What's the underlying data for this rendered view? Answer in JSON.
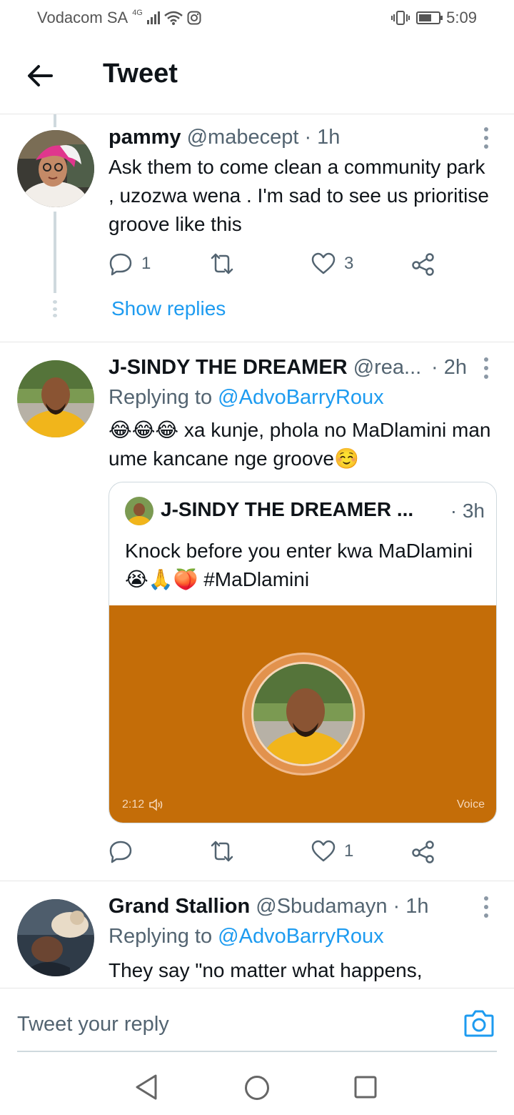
{
  "status_bar": {
    "carrier": "Vodacom SA",
    "network": "4G",
    "time": "5:09"
  },
  "header": {
    "title": "Tweet"
  },
  "tweets": [
    {
      "name": "pammy",
      "handle": "@mabecept",
      "time": "· 1h",
      "text": "Ask them to come clean a community park , uzozwa wena . I'm sad to see us prioritise groove like this",
      "reply_count": "1",
      "like_count": "3",
      "show_replies": "Show replies"
    },
    {
      "name": "J-SINDY THE DREAMER",
      "handle": "@rea...",
      "time": "· 2h",
      "replying_prefix": "Replying to",
      "replying_to": "@AdvoBarryRoux",
      "text": "😂😂😂 xa kunje, phola no MaDlamini man ume kancane nge groove☺️",
      "like_count": "1",
      "quote": {
        "name": "J-SINDY THE DREAMER ...",
        "time": "· 3h",
        "text": "Knock before you enter kwa MaDlamini😭🙏🍑 #MaDlamini",
        "duration": "2:12",
        "media_label": "Voice"
      }
    },
    {
      "name": "Grand Stallion",
      "handle": "@Sbudamayn",
      "time": "· 1h",
      "replying_prefix": "Replying to",
      "replying_to": "@AdvoBarryRoux",
      "text": "They say \"no matter what happens,"
    }
  ],
  "reply_bar": {
    "placeholder": "Tweet your reply"
  },
  "colors": {
    "link": "#1d9bf0",
    "media_bg": "#c46d08"
  }
}
